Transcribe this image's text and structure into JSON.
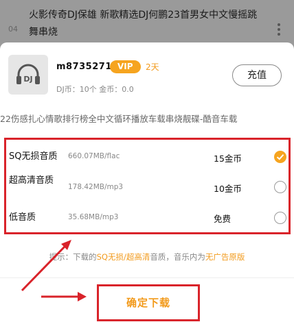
{
  "background": {
    "track_title": "火影传奇DJ保雄 新歌精选DJ何鹏23首男女中文慢摇跳舞串烧",
    "track_index": "04"
  },
  "user": {
    "name": "m87352719",
    "vip_label": "VIP",
    "vip_days": "2天",
    "wallet": "DJ币：10个   金币：0.0",
    "recharge_label": "充值",
    "avatar_label": "DJ"
  },
  "song_title": "22伤感扎心情歌排行榜全中文循环播放车载串烧靓碟-酷音车载",
  "options": [
    {
      "name": "SQ无损音质",
      "size": "660.07MB/flac",
      "price": "15金币",
      "selected": true
    },
    {
      "name": "超高清音质",
      "size": "178.42MB/mp3",
      "price": "10金币",
      "selected": false
    },
    {
      "name": "低音质",
      "size": "35.68MB/mp3",
      "price": "免费",
      "selected": false
    }
  ],
  "tip": {
    "prefix": "提示：下载的",
    "highlight1": "SQ无损/超高清",
    "middle": "音质，音乐内为",
    "highlight2": "无广告原版"
  },
  "confirm_label": "确定下载",
  "colors": {
    "accent": "#f6a41f",
    "annotation_red": "#d9232a"
  }
}
